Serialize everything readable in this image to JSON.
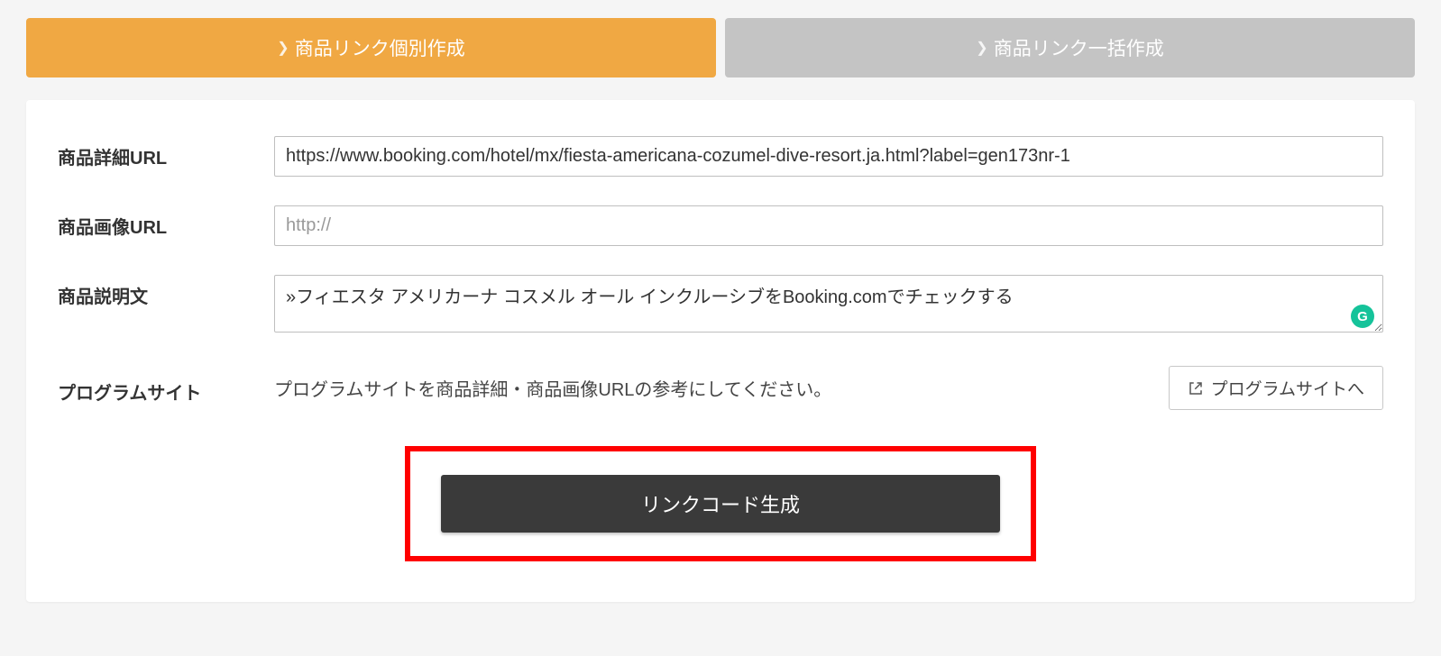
{
  "tabs": {
    "individual": "商品リンク個別作成",
    "bulk": "商品リンク一括作成"
  },
  "labels": {
    "detail_url": "商品詳細URL",
    "image_url": "商品画像URL",
    "description": "商品説明文",
    "program_site": "プログラムサイト"
  },
  "fields": {
    "detail_url_value": "https://www.booking.com/hotel/mx/fiesta-americana-cozumel-dive-resort.ja.html?label=gen173nr-1",
    "image_url_placeholder": "http://",
    "description_value": "»フィエスタ アメリカーナ コスメル オール インクルーシブをBooking.comでチェックする"
  },
  "program": {
    "help_text": "プログラムサイトを商品詳細・商品画像URLの参考にしてください。",
    "button_label": "プログラムサイトへ"
  },
  "buttons": {
    "generate": "リンクコード生成"
  },
  "icons": {
    "grammarly": "G"
  }
}
